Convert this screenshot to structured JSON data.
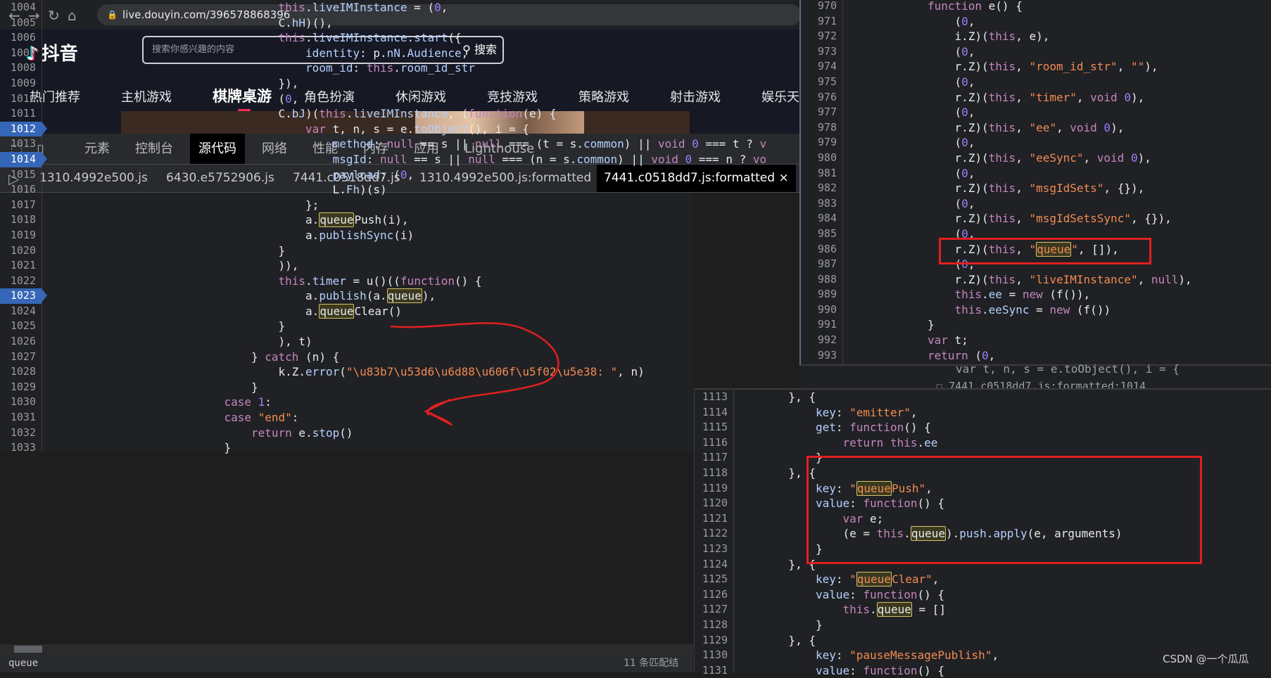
{
  "browser": {
    "url": "live.douyin.com/396578868396"
  },
  "douyin": {
    "logo_text": "抖音",
    "search_placeholder": "搜索你感兴趣的内容",
    "search_button": "搜索",
    "categories": [
      "热门推荐",
      "主机游戏",
      "棋牌桌游",
      "角色扮演",
      "休闲游戏",
      "竞技游戏",
      "策略游戏",
      "射击游戏",
      "娱乐天"
    ],
    "active_category": "棋牌桌游"
  },
  "devtools": {
    "tabs": [
      "元素",
      "控制台",
      "源代码",
      "网络",
      "性能",
      "内存",
      "应用",
      "Lighthouse"
    ],
    "active_tab": "源代码",
    "file_tabs": [
      "1310.4992e500.js",
      "6430.e5752906.js",
      "7441.c0518dd7.js",
      "1310.4992e500.js:formatted",
      "7441.c0518dd7.js:formatted"
    ],
    "active_file": "7441.c0518dd7.js:formatted",
    "close_glyph": "×",
    "bottom_search": "queue",
    "bottom_status": "11 条匹配结"
  },
  "left_code": {
    "line_numbers": [
      "1004",
      "1005",
      "1006",
      "1007",
      "1008",
      "1009",
      "1010",
      "1011",
      "1012",
      "1013",
      "1014",
      "1015",
      "1016",
      "1017",
      "1018",
      "1019",
      "1020",
      "1021",
      "1022",
      "1023",
      "1024",
      "1025",
      "1026",
      "1027",
      "1028",
      "1029",
      "1030",
      "1031",
      "1032",
      "1033"
    ],
    "breakpoints": [
      "1012",
      "1014",
      "1023"
    ]
  },
  "top_overlay": {
    "line_numbers": [
      "970",
      "971",
      "972",
      "973",
      "974",
      "975",
      "976",
      "977",
      "978",
      "979",
      "980",
      "981",
      "982",
      "983",
      "984",
      "985",
      "986",
      "987",
      "988",
      "989",
      "990",
      "991",
      "992",
      "993"
    ]
  },
  "peek": {
    "code": "var t, n, s = e.toObject(), i = {",
    "ref": "7441.c0518dd7.js:formatted:1014"
  },
  "bottom_overlay": {
    "line_numbers": [
      "1113",
      "1114",
      "1115",
      "1116",
      "1117",
      "1118",
      "1119",
      "1120",
      "1121",
      "1122",
      "1123",
      "1124",
      "1125",
      "1126",
      "1127",
      "1128",
      "1129",
      "1130",
      "1131"
    ]
  },
  "watermark": "CSDN @一个瓜瓜",
  "colors": {
    "highlight_box": "#e02020",
    "breakpoint": "#3566b7",
    "accent": "#fe2c55"
  }
}
